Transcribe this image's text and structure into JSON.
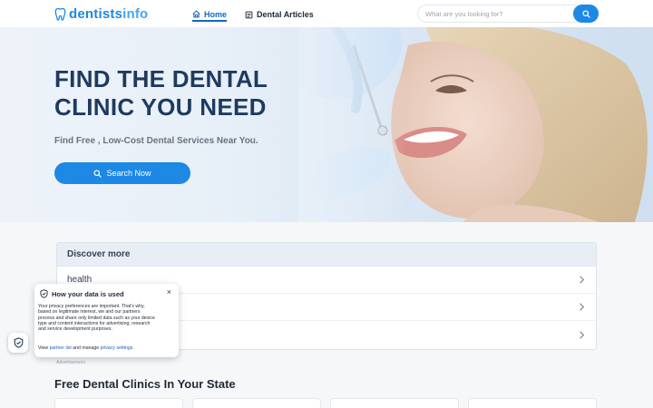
{
  "header": {
    "logo_main": "dentists",
    "logo_accent": "info",
    "nav": [
      {
        "label": "Home",
        "active": true
      },
      {
        "label": "Dental Articles",
        "active": false
      }
    ],
    "search_placeholder": "What are you looking for?"
  },
  "hero": {
    "title_line1": "FIND THE DENTAL",
    "title_line2": "CLINIC YOU NEED",
    "subtitle": "Find Free , Low-Cost Dental Services Near You.",
    "button_label": "Search Now"
  },
  "discover": {
    "title": "Discover more",
    "items": [
      "health",
      "",
      ""
    ],
    "ad_label": "Advertisement"
  },
  "section": {
    "title": "Free Dental Clinics In Your State"
  },
  "privacy": {
    "title": "How your data is used",
    "body": "Your privacy preferences are important. That's why, based on legitimate interest, we and our partners process and share only limited data such as your device type and content interactions for advertising, research and service development purposes.",
    "foot_prefix": "View",
    "partner_link": "partner list",
    "foot_middle": "and manage",
    "settings_link": "privacy settings",
    "foot_suffix": ".",
    "close_glyph": "×"
  },
  "colors": {
    "brand": "#1e88e5",
    "nav_active": "#1565c0",
    "hero_title": "#1e3a5f"
  },
  "icons": {
    "logo": "tooth-icon",
    "home": "home-icon",
    "articles": "article-icon",
    "search": "search-icon",
    "chevron": "chevron-right-icon",
    "shield": "shield-icon"
  }
}
